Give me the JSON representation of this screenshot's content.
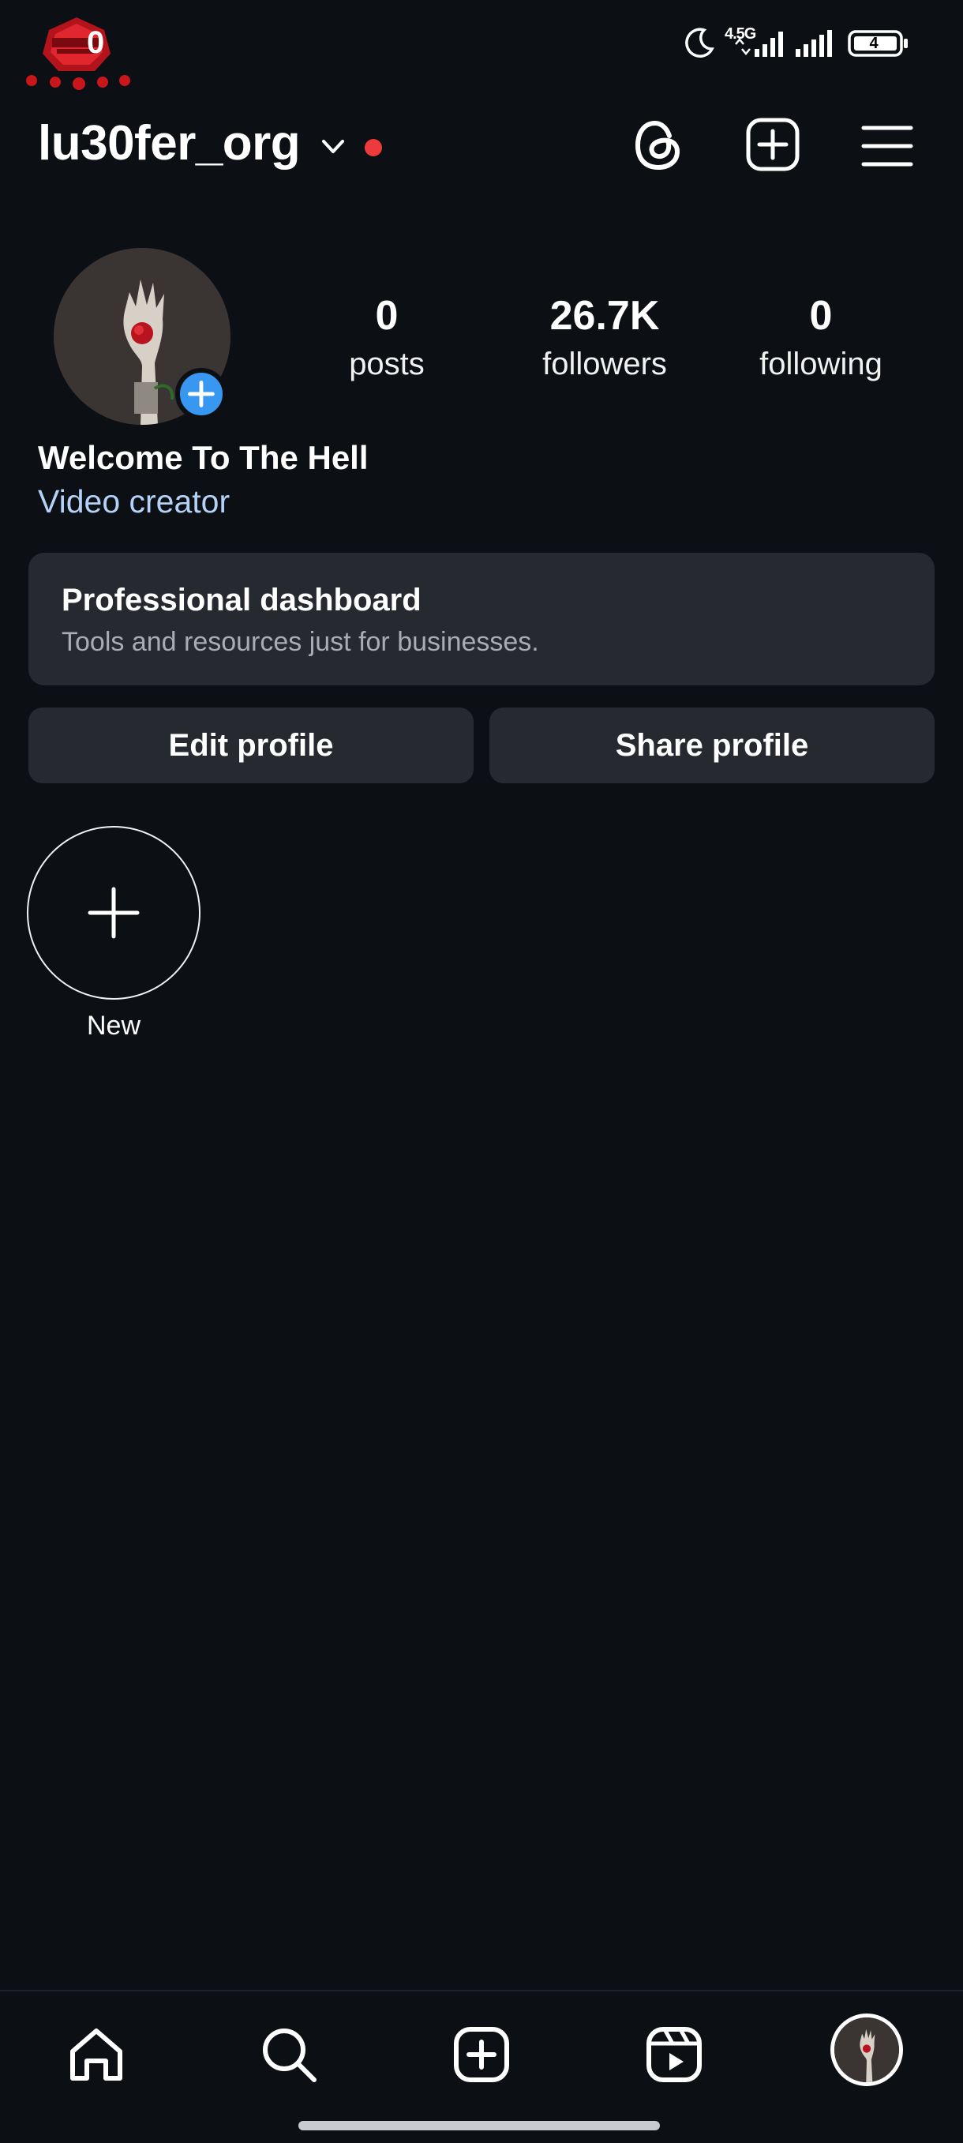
{
  "status_bar": {
    "time": "0",
    "network_label": "4.5G",
    "battery_level": "4"
  },
  "header": {
    "username": "lu30fer_org"
  },
  "profile": {
    "stats": [
      {
        "value": "0",
        "label": "posts"
      },
      {
        "value": "26.7K",
        "label": "followers"
      },
      {
        "value": "0",
        "label": "following"
      }
    ],
    "display_name": "Welcome To The Hell",
    "category": "Video creator"
  },
  "dashboard": {
    "title": "Professional dashboard",
    "subtitle": "Tools and resources just for businesses."
  },
  "buttons": {
    "edit_profile": "Edit profile",
    "share_profile": "Share profile"
  },
  "highlights": {
    "new_label": "New"
  },
  "icons": {
    "header": [
      "chevron-down-icon",
      "threads-icon",
      "create-plus-icon",
      "menu-icon"
    ],
    "nav": [
      "home-icon",
      "search-icon",
      "create-icon",
      "reels-icon",
      "profile-avatar"
    ]
  },
  "colors": {
    "background": "#0c0f14",
    "card": "#262a30",
    "accent_blue": "#3897f0",
    "link_blue": "#b4d1f6",
    "notification_red": "#ed3b3b"
  }
}
